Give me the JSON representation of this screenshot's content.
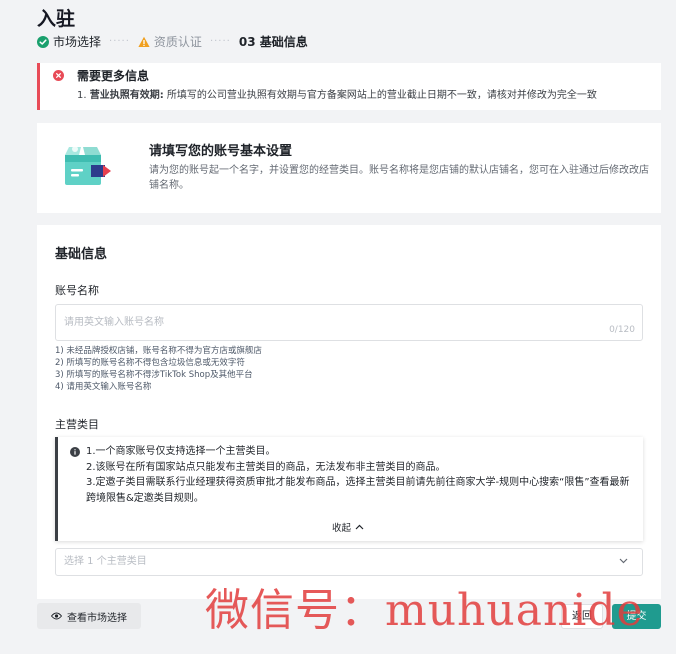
{
  "header": {
    "title": "入驻",
    "steps": [
      {
        "label": "市场选择",
        "status": "done"
      },
      {
        "label": "资质认证",
        "status": "warning"
      },
      {
        "label": "03 基础信息",
        "status": "current"
      }
    ]
  },
  "error_banner": {
    "title": "需要更多信息",
    "prefix": "1. ",
    "label": "营业执照有效期:",
    "message": " 所填写的公司营业执照有效期与官方备案网站上的营业截止日期不一致，请核对并修改为完全一致"
  },
  "setup_card": {
    "title": "请填写您的账号基本设置",
    "description": "请为您的账号起一个名字，并设置您的经营类目。账号名称将是您店铺的默认店铺名，您可在入驻通过后修改改店铺名称。"
  },
  "basic_info": {
    "section_title": "基础信息",
    "account_name": {
      "label": "账号名称",
      "placeholder": "请用英文输入账号名称",
      "value": "",
      "counter": "0/120",
      "hints": [
        "1) 未经品牌授权店铺，账号名称不得为官方店或旗舰店",
        "2) 所填写的账号名称不得包含垃圾信息或无效字符",
        "3) 所填写的账号名称不得涉TikTok Shop及其他平台",
        "4) 请用英文输入账号名称"
      ]
    },
    "main_category": {
      "label": "主营类目",
      "notice_lines": [
        "1.一个商家账号仅支持选择一个主营类目。",
        "2.该账号在所有国家站点只能发布主营类目的商品，无法发布非主营类目的商品。",
        "3.定邀子类目需联系行业经理获得资质审批才能发布商品，选择主营类目前请先前往商家大学-规则中心搜索“限售”查看最新跨境限售&定邀类目规则。"
      ],
      "collapse_label": "收起",
      "select_placeholder": "选择 1 个主营类目"
    }
  },
  "footer": {
    "view_market_label": "查看市场选择",
    "back_label": "返回",
    "submit_label": "提交"
  },
  "watermark": "微信号：muhuanide",
  "colors": {
    "error": "#e84b57",
    "success": "#1aa06d",
    "warning": "#f0a020",
    "primary": "#1f9b8f"
  }
}
